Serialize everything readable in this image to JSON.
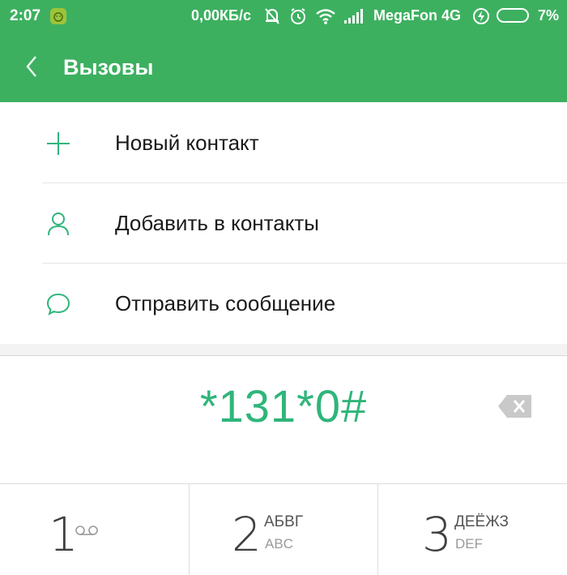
{
  "status_bar": {
    "time": "2:07",
    "speed": "0,00КБ/с",
    "carrier": "MegaFon 4G",
    "battery": "7%"
  },
  "header": {
    "title": "Вызовы"
  },
  "menu": [
    {
      "label": "Новый контакт",
      "icon": "plus-icon"
    },
    {
      "label": "Добавить в контакты",
      "icon": "person-icon"
    },
    {
      "label": "Отправить сообщение",
      "icon": "chat-bubble-icon"
    }
  ],
  "dialer": {
    "number": "*131*0#"
  },
  "keypad": [
    {
      "digit": "1",
      "letters": "",
      "latin": ""
    },
    {
      "digit": "2",
      "letters": "АБВГ",
      "latin": "ABC"
    },
    {
      "digit": "3",
      "letters": "ДЕЁЖЗ",
      "latin": "DEF"
    }
  ],
  "colors": {
    "accent": "#3db060",
    "number": "#2fb57a"
  }
}
